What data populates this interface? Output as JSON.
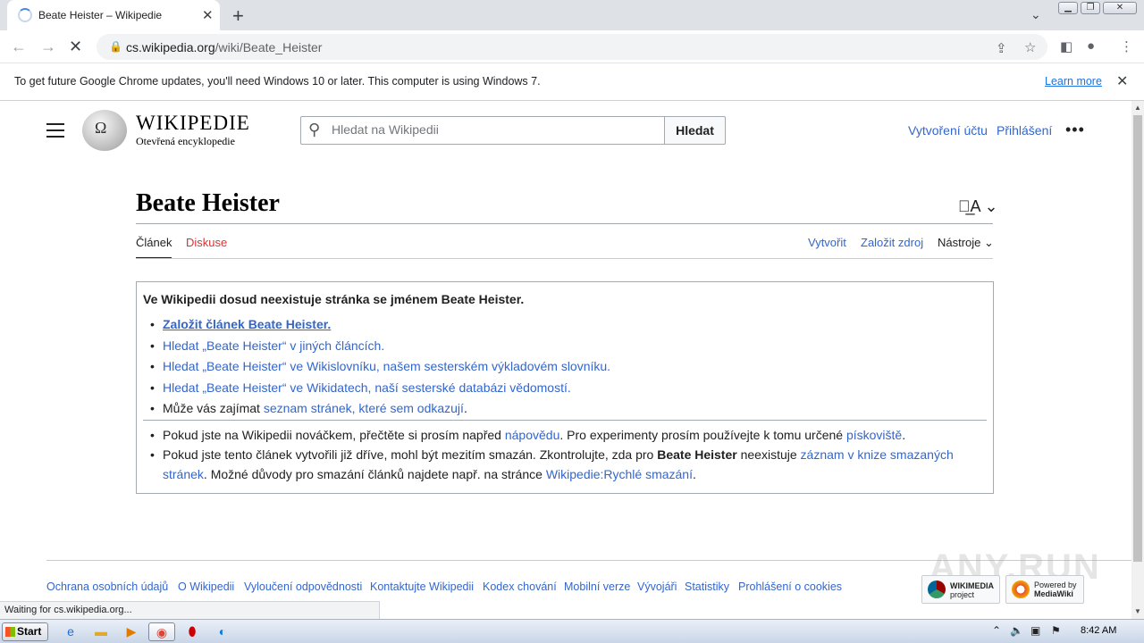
{
  "browser": {
    "tab_title": "Beate Heister – Wikipedie",
    "url_host": "cs.wikipedia.org",
    "url_path": "/wiki/Beate_Heister",
    "infobar_message": "To get future Google Chrome updates, you'll need Windows 10 or later. This computer is using Windows 7.",
    "infobar_link": "Learn more",
    "status_text": "Waiting for cs.wikipedia.org..."
  },
  "site": {
    "wordmark": "WIKIPEDIE",
    "tagline": "Otevřená encyklopedie",
    "search_placeholder": "Hledat na Wikipedii",
    "search_button": "Hledat",
    "create_account": "Vytvoření účtu",
    "login": "Přihlášení"
  },
  "page": {
    "title": "Beate Heister",
    "tabs": {
      "article": "Článek",
      "talk": "Diskuse",
      "create": "Vytvořit",
      "create_source": "Založit zdroj",
      "tools": "Nástroje"
    },
    "notice": {
      "heading": "Ve Wikipedii dosud neexistuje stránka se jménem Beate Heister.",
      "create_link": "Založit článek Beate Heister.",
      "search_articles": "Hledat „Beate Heister“ v jiných článcích.",
      "search_wiktionary": "Hledat „Beate Heister“ ve Wikislovníku, našem sesterském výkladovém slovníku.",
      "search_wikidata": "Hledat „Beate Heister“ ve Wikidatech, naší sesterské databázi vědomostí.",
      "interest_prefix": "Může vás zajímat ",
      "interest_link": "seznam stránek, které sem odkazují",
      "interest_suffix": ".",
      "newbie_prefix": "Pokud jste na Wikipedii nováčkem, přečtěte si prosím napřed ",
      "newbie_help_link": "nápovědu",
      "newbie_middle": ". Pro experimenty prosím používejte k tomu určené ",
      "newbie_sandbox_link": "pískoviště",
      "newbie_suffix": ".",
      "deleted_prefix": "Pokud jste tento článek vytvořili již dříve, mohl být mezitím smazán. Zkontrolujte, zda pro ",
      "deleted_bold": "Beate Heister",
      "deleted_middle": " neexistuje ",
      "deleted_log_link": "záznam v knize smazaných stránek",
      "deleted_after": ". Možné důvody pro smazání článků najdete např. na stránce ",
      "deleted_policy_link": "Wikipedie:Rychlé smazání",
      "deleted_suffix": "."
    }
  },
  "footer": {
    "links": [
      "Ochrana osobních údajů",
      "O Wikipedii",
      "Vyloučení odpovědnosti",
      "Kontaktujte Wikipedii",
      "Kodex chování",
      "Mobilní verze",
      "Vývojáři",
      "Statistiky",
      "Prohlášení o cookies"
    ],
    "badge_wikimedia_1": "WIKIMEDIA",
    "badge_wikimedia_2": "project",
    "badge_mediawiki_1": "Powered by",
    "badge_mediawiki_2": "MediaWiki",
    "watermark": "ANY.RUN"
  },
  "taskbar": {
    "start_label": "Start",
    "clock": "8:42 AM"
  }
}
